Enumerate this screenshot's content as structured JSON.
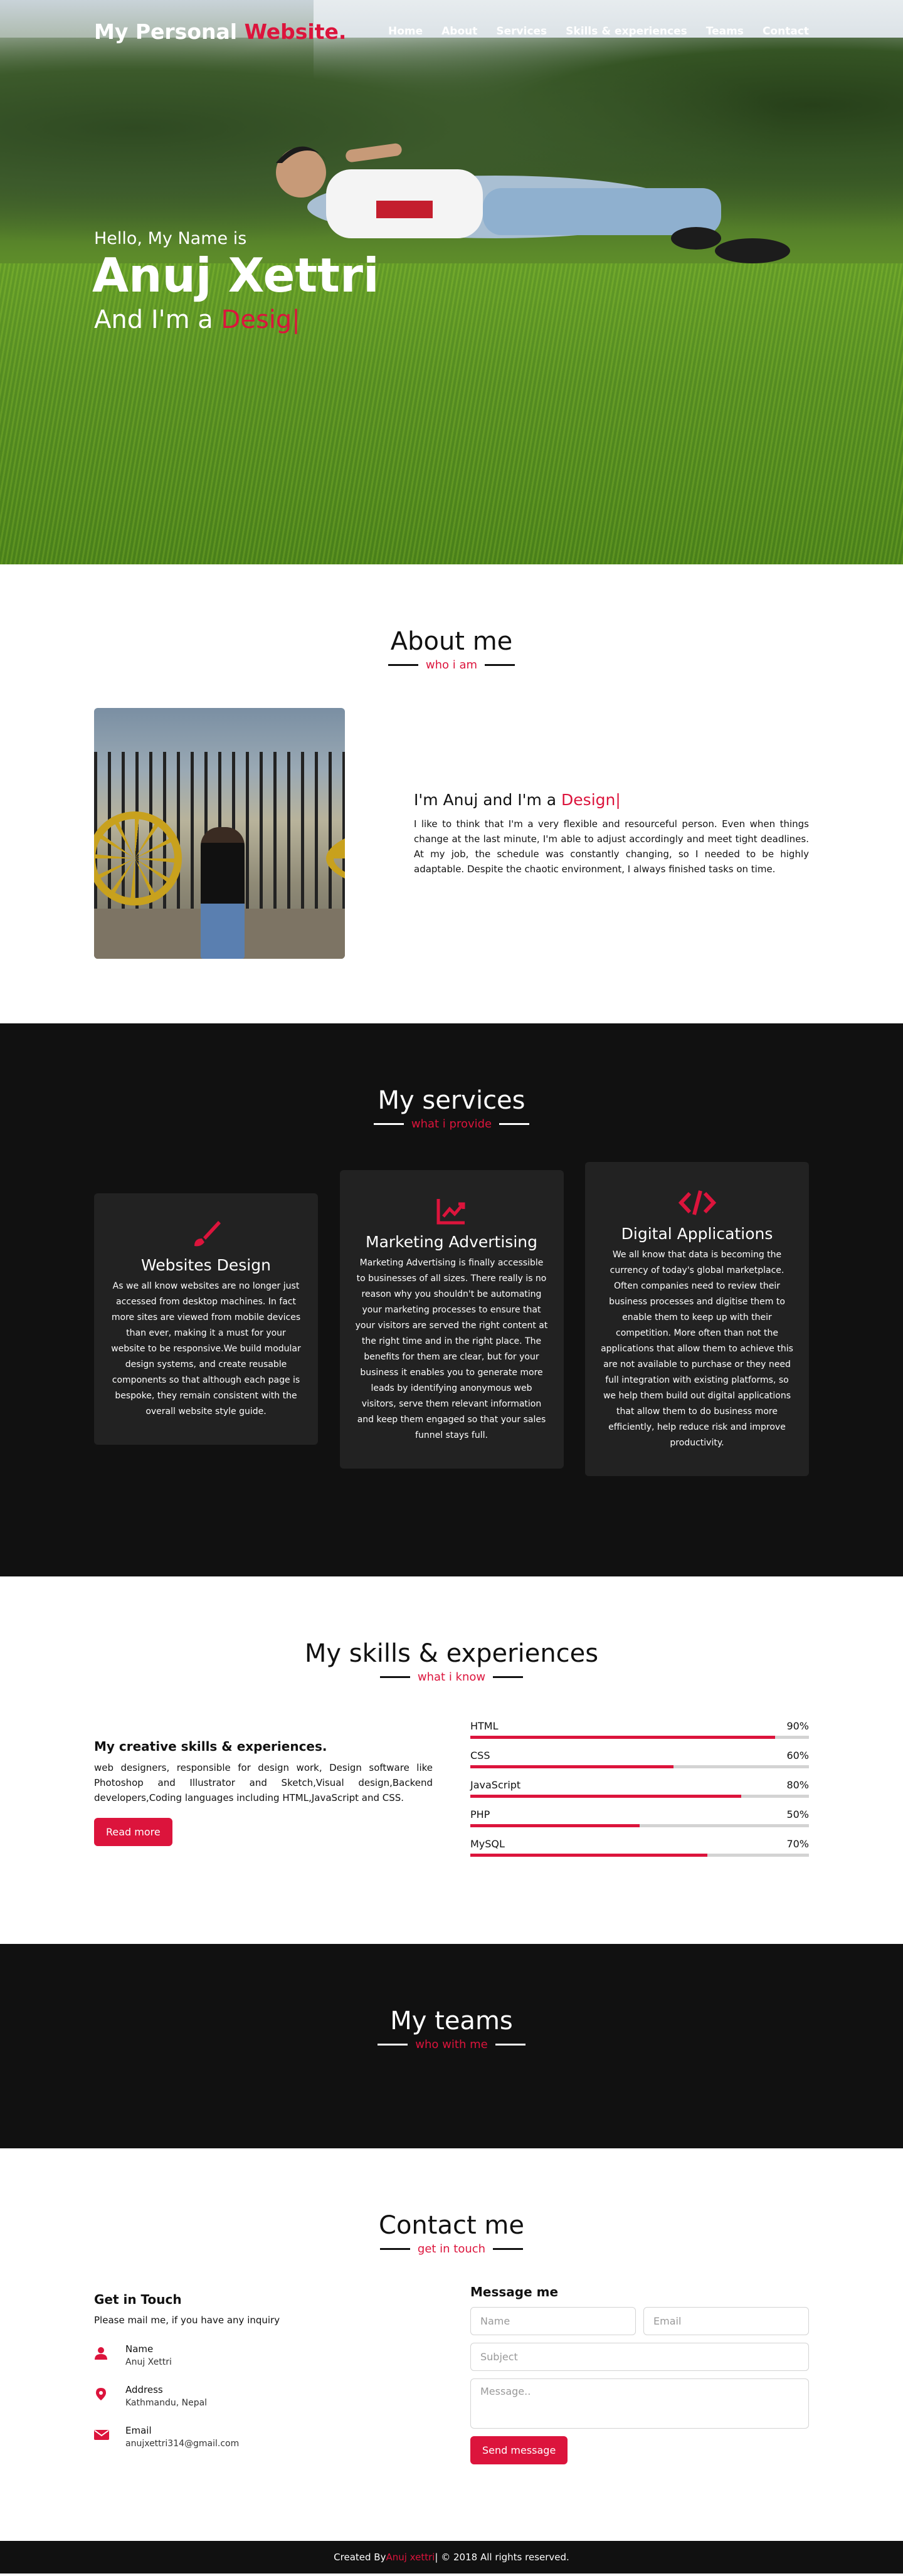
{
  "navbar": {
    "logo_part1": "My Personal ",
    "logo_part2": "Website.",
    "menu": [
      "Home",
      "About",
      "Services",
      "Skills & experiences",
      "Teams",
      "Contact"
    ]
  },
  "home": {
    "greeting": "Hello, My Name is",
    "name": "Anuj Xettri",
    "role_prefix": "And I'm a ",
    "role_typing": "Desig|"
  },
  "about": {
    "title": "About me",
    "subtitle": "who i am",
    "heading_prefix": "I'm Anuj and I'm a ",
    "heading_typing": "Design|",
    "paragraph": "I like to think that I'm a very flexible and resourceful person. Even when things change at the last minute, I'm able to adjust accordingly and meet tight deadlines. At my job, the schedule was constantly changing, so I needed to be highly adaptable. Despite the chaotic environment, I always finished tasks on time."
  },
  "services": {
    "title": "My services",
    "subtitle": "what i provide",
    "cards": [
      {
        "icon": "paint-brush-icon",
        "title": "Websites Design",
        "text": "As we all know websites are no longer just accessed from desktop machines. In fact more sites are viewed from mobile devices than ever, making it a must for your website to be responsive.We build modular design systems, and create reusable components so that although each page is bespoke, they remain consistent with the overall website style guide."
      },
      {
        "icon": "chart-line-icon",
        "title": "Marketing Advertising",
        "text": "Marketing Advertising is finally accessible to businesses of all sizes. There really is no reason why you shouldn't be automating your marketing processes to ensure that your visitors are served the right content at the right time and in the right place. The benefits for them are clear, but for your business it enables you to generate more leads by identifying anonymous web visitors, serve them relevant information and keep them engaged so that your sales funnel stays full."
      },
      {
        "icon": "code-icon",
        "title": "Digital Applications",
        "text": "We all know that data is becoming the currency of today's global marketplace. Often companies need to review their business processes and digitise them to enable them to keep up with their competition. More often than not the applications that allow them to achieve this are not available to purchase or they need full integration with existing platforms, so we help them build out digital applications that allow them to do business more efficiently, help reduce risk and improve productivity."
      }
    ]
  },
  "skills": {
    "title": "My skills & experiences",
    "subtitle": "what i know",
    "heading": "My creative skills & experiences.",
    "paragraph": "web designers, responsible for design work, Design software like Photoshop and Illustrator and Sketch,Visual design,Backend developers,Coding languages including HTML,JavaScript and CSS.",
    "button": "Read more",
    "bars": [
      {
        "name": "HTML",
        "percent_label": "90%",
        "value": 90
      },
      {
        "name": "CSS",
        "percent_label": "60%",
        "value": 60
      },
      {
        "name": "JavaScript",
        "percent_label": "80%",
        "value": 80
      },
      {
        "name": "PHP",
        "percent_label": "50%",
        "value": 50
      },
      {
        "name": "MySQL",
        "percent_label": "70%",
        "value": 70
      }
    ]
  },
  "teams": {
    "title": "My teams",
    "subtitle": "who with me"
  },
  "contact": {
    "title": "Contact me",
    "subtitle": "get in touch",
    "left_title": "Get in Touch",
    "left_text": "Please mail me, if you have any inquiry",
    "rows": [
      {
        "icon": "user-icon",
        "head": "Name",
        "value": "Anuj Xettri"
      },
      {
        "icon": "map-marker-icon",
        "head": "Address",
        "value": "Kathmandu, Nepal"
      },
      {
        "icon": "envelope-icon",
        "head": "Email",
        "value": "anujxettri314@gmail.com"
      }
    ],
    "form_title": "Message me",
    "placeholders": {
      "name": "Name",
      "email": "Email",
      "subject": "Subject",
      "message": "Message.."
    },
    "send_button": "Send message"
  },
  "footer": {
    "prefix": "Created By ",
    "author": "Anuj xettri",
    "suffix": " | © 2018 All rights reserved."
  },
  "colors": {
    "accent": "#dc143c",
    "dark": "#111111",
    "card": "#222222"
  }
}
